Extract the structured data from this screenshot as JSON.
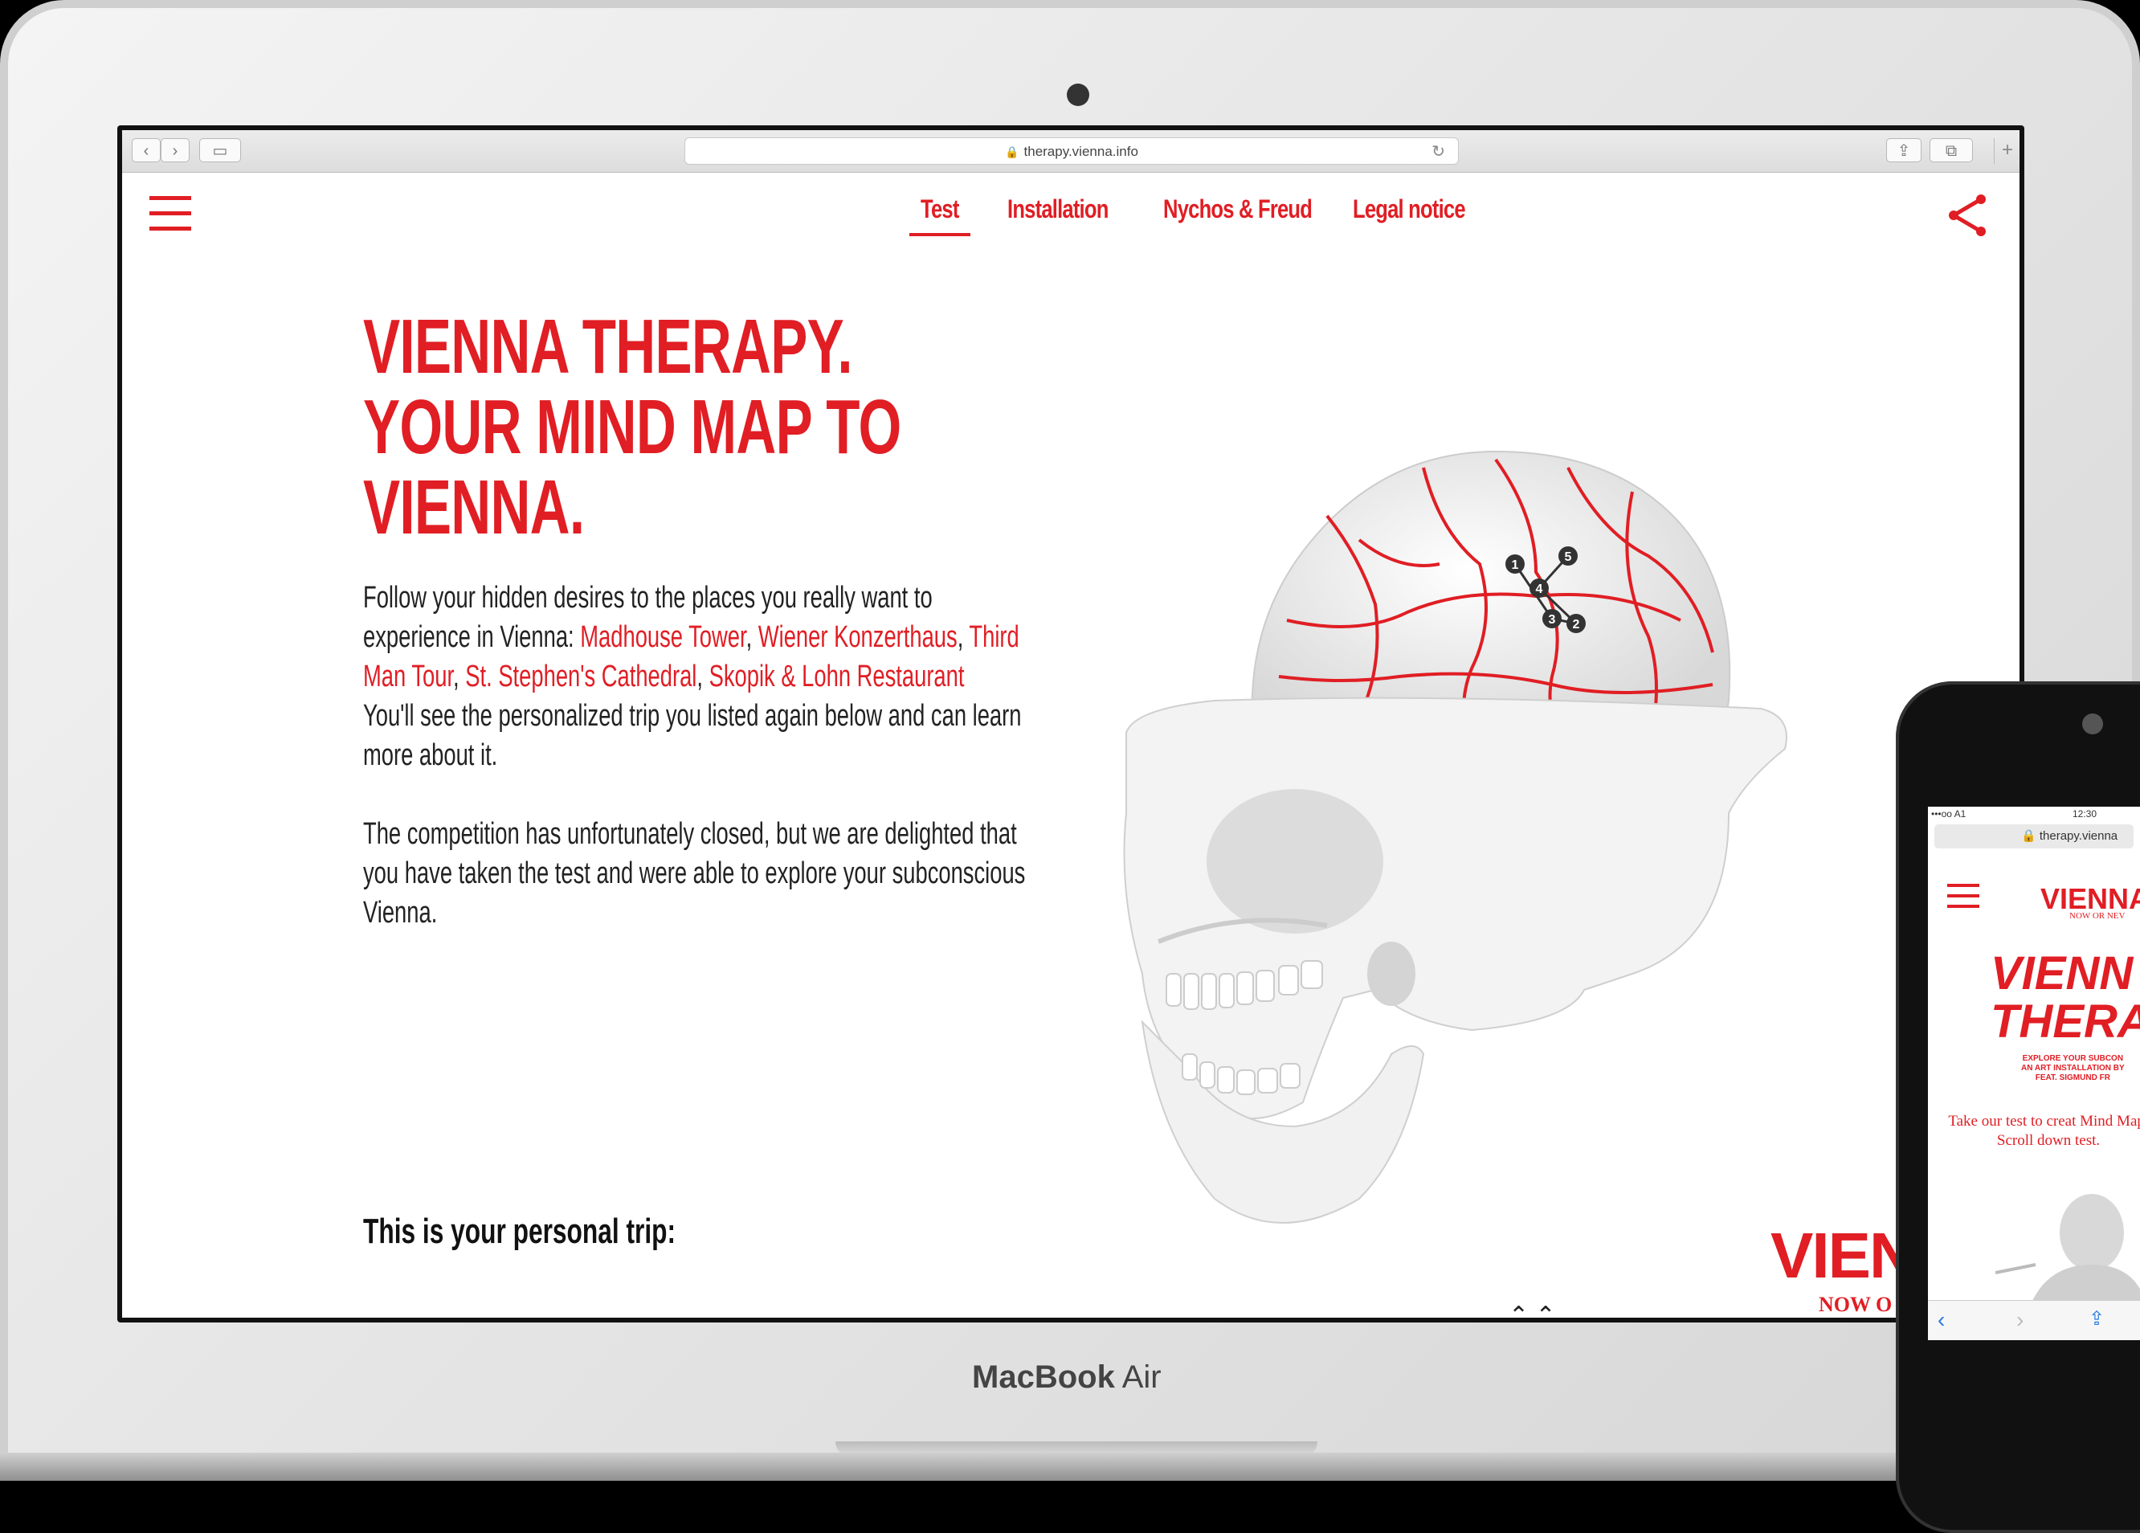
{
  "device_label": {
    "brand": "MacBook",
    "model": "Air"
  },
  "browser": {
    "url": "therapy.vienna.info"
  },
  "nav": {
    "items": [
      "Test",
      "Installation",
      "Nychos & Freud",
      "Legal notice"
    ],
    "active": "Test"
  },
  "hero": {
    "headline": [
      "VIENNA THERAPY.",
      "YOUR MIND MAP TO",
      "VIENNA."
    ],
    "p1_intro": "Follow your hidden desires to the places you really want to experience in Vienna: ",
    "places": [
      "Madhouse Tower",
      "Wiener Konzerthaus",
      "Third Man Tour",
      "St. Stephen's Cathedral",
      "Skopik & Lohn Restaurant"
    ],
    "p1_outro": "You'll see the personalized trip you listed again below and can learn more about it.",
    "p2": "The competition has unfortunately closed, but we are delighted that you have taken the test and were able to explore your subconscious Vienna.",
    "trip_heading": "This is your personal trip:"
  },
  "brain_markers": [
    "1",
    "2",
    "3",
    "4",
    "5"
  ],
  "logo": {
    "main": "VIEN",
    "sub": "NOW O"
  },
  "phone": {
    "status_left": "•••oo A1",
    "time": "12:30",
    "url": "therapy.vienna",
    "logo": "VIENNA",
    "tagline": "NOW OR NEV",
    "title_lines": [
      "VIENN",
      "THERA"
    ],
    "subtitle_lines": [
      "EXPLORE YOUR SUBCON",
      "AN ART INSTALLATION BY",
      "FEAT. SIGMUND FR"
    ],
    "description": "Take our test to creat Mind Map. Scroll down test."
  },
  "colors": {
    "accent": "#e01e24",
    "text": "#222222"
  },
  "icons": [
    "menu-icon",
    "share-icon",
    "back-icon",
    "forward-icon",
    "sidebar-icon",
    "lock-icon",
    "reload-icon",
    "share-sheet-icon",
    "tabs-icon"
  ]
}
